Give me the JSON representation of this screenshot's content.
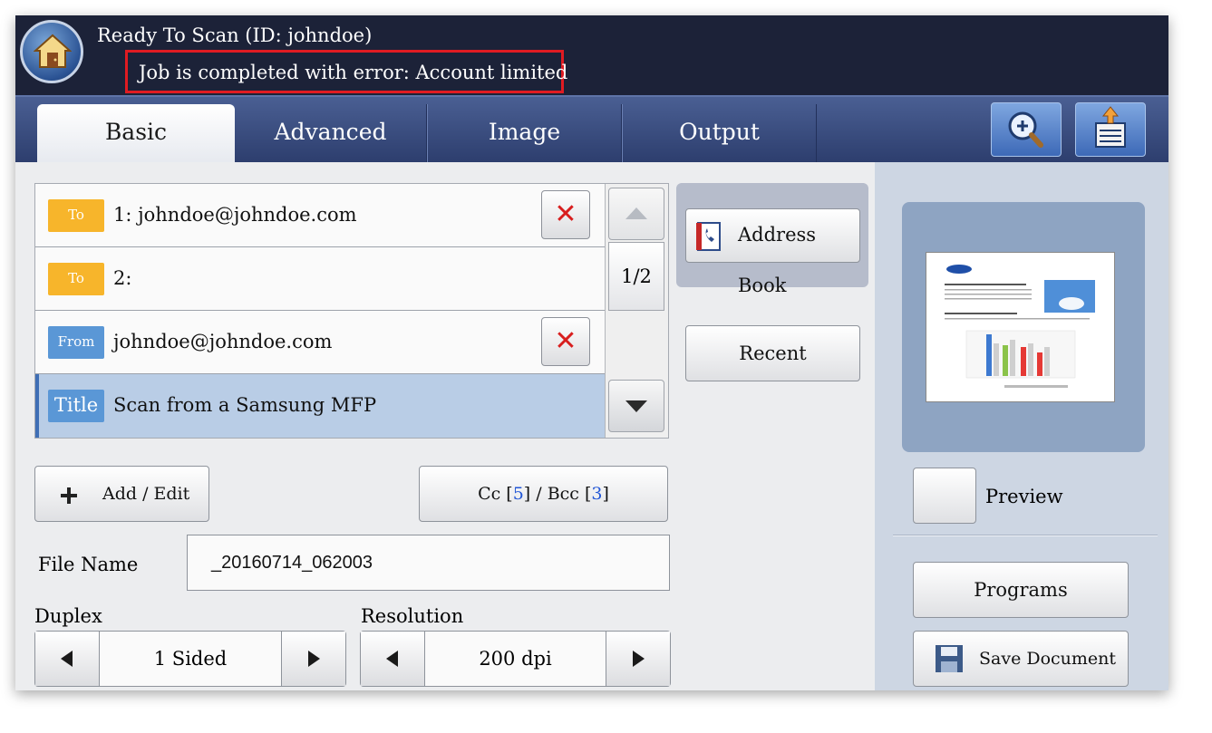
{
  "header": {
    "status": "Ready To Scan (ID: johndoe)",
    "error": "Job is completed with error: Account limited"
  },
  "tabs": [
    "Basic",
    "Advanced",
    "Image",
    "Output"
  ],
  "recipients": [
    {
      "badge": "To",
      "text": "1: johndoe@johndoe.com"
    },
    {
      "badge": "To",
      "text": "2:"
    },
    {
      "badge": "From",
      "text": "johndoe@johndoe.com"
    },
    {
      "badge": "Title",
      "text": "Scan from a Samsung MFP"
    }
  ],
  "pager": "1/2",
  "buttons": {
    "address_book": "Address Book",
    "recent": "Recent",
    "add_edit": "Add / Edit",
    "cc_label": "Cc",
    "cc_count": "5",
    "bcc_label": "Bcc",
    "bcc_count": "3",
    "preview": "Preview",
    "programs": "Programs",
    "save_document": "Save Document"
  },
  "file_name": {
    "label": "File Name",
    "value": "_20160714_062003"
  },
  "duplex": {
    "label": "Duplex",
    "value": "1 Sided"
  },
  "resolution": {
    "label": "Resolution",
    "value": "200 dpi"
  },
  "icons": [
    "home-icon",
    "zoom-in-icon",
    "job-list-icon",
    "address-book-icon",
    "save-icon",
    "plus-icon",
    "close-icon"
  ],
  "colors": {
    "to_badge": "#f7b52b",
    "from_badge": "#5a97d6",
    "error_outline": "#e01b22",
    "header_bg": "#1c2238"
  }
}
